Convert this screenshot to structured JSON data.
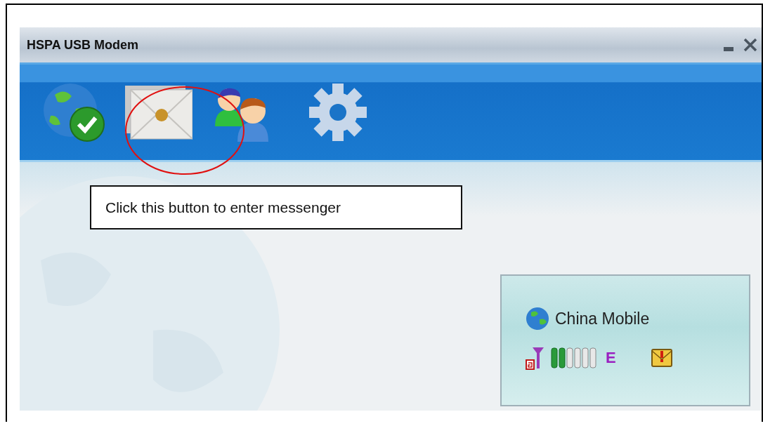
{
  "window": {
    "title": "HSPA USB Modem"
  },
  "annotation": {
    "text": "Click this button to enter messenger"
  },
  "status": {
    "operator": "China Mobile",
    "network_type": "E"
  }
}
